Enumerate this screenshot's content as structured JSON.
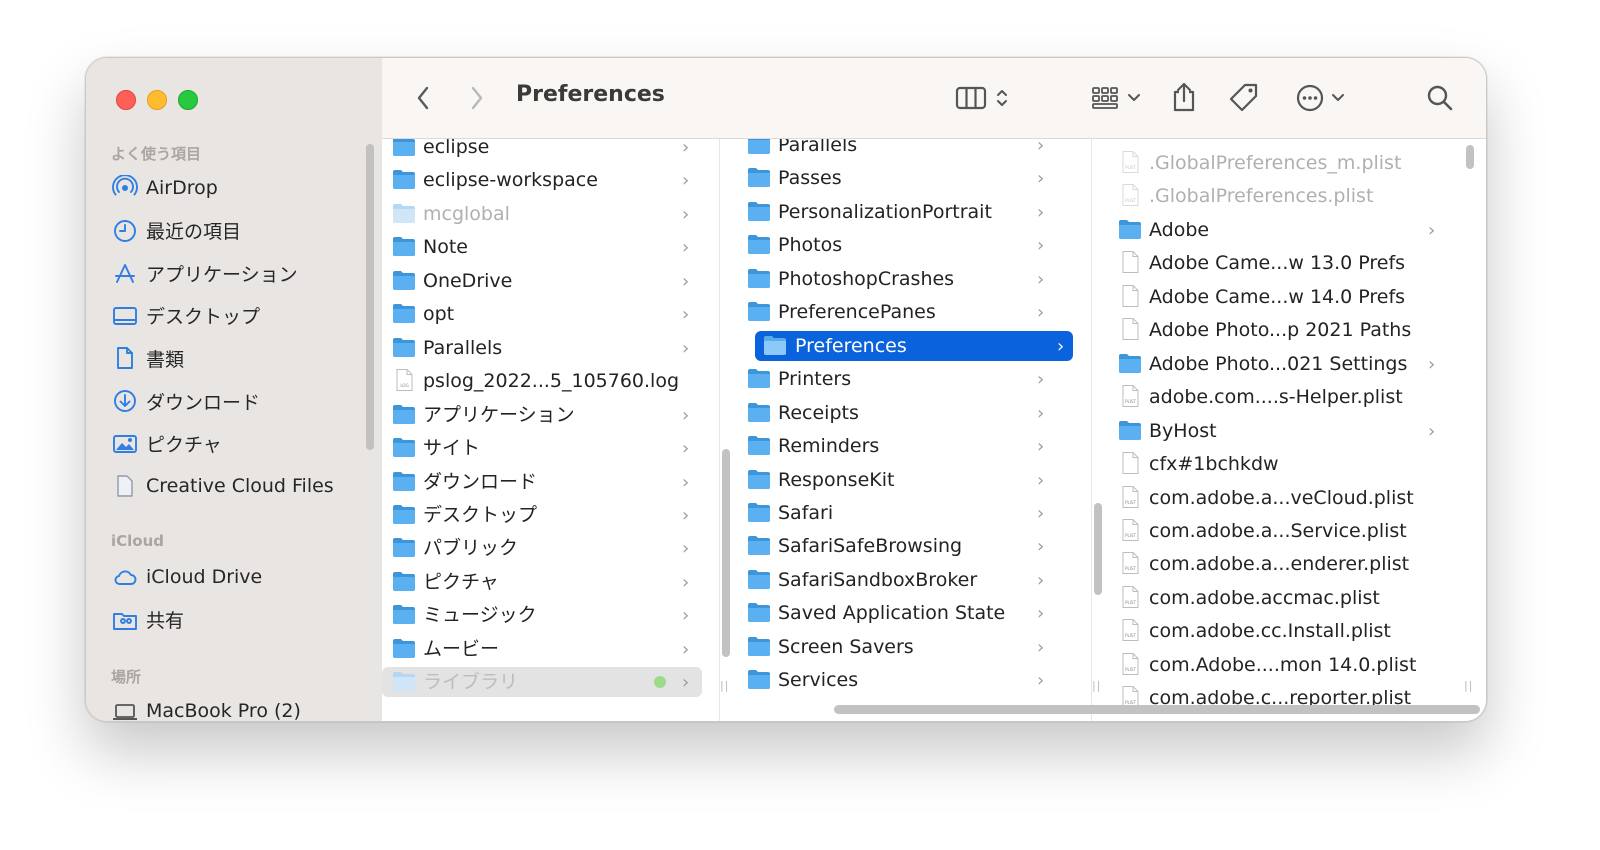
{
  "window": {
    "title": "Preferences"
  },
  "toolbar": {
    "back_icon": "chevron-left-icon",
    "forward_icon": "chevron-right-icon",
    "view_icon": "columns-view-icon",
    "group_icon": "grid-group-icon",
    "share_icon": "share-icon",
    "tag_icon": "tag-icon",
    "more_icon": "ellipsis-circle-icon",
    "search_icon": "search-icon"
  },
  "sidebar": {
    "favorites_header": "よく使う項目",
    "favorites": [
      {
        "label": "AirDrop",
        "icon": "airdrop-icon"
      },
      {
        "label": "最近の項目",
        "icon": "clock-icon"
      },
      {
        "label": "アプリケーション",
        "icon": "applications-icon"
      },
      {
        "label": "デスクトップ",
        "icon": "desktop-icon"
      },
      {
        "label": "書類",
        "icon": "document-icon"
      },
      {
        "label": "ダウンロード",
        "icon": "download-icon"
      },
      {
        "label": "ピクチャ",
        "icon": "photo-icon"
      },
      {
        "label": "Creative Cloud Files",
        "icon": "file-icon"
      }
    ],
    "icloud_header": "iCloud",
    "icloud": [
      {
        "label": "iCloud Drive",
        "icon": "cloud-icon"
      },
      {
        "label": "共有",
        "icon": "shared-folder-icon"
      }
    ],
    "locations_header": "場所",
    "locations": [
      {
        "label": "MacBook Pro (2)",
        "icon": "laptop-icon"
      }
    ]
  },
  "columns": {
    "col1": [
      {
        "name": "eclipse",
        "kind": "folder",
        "chevron": ">"
      },
      {
        "name": "eclipse-workspace",
        "kind": "folder",
        "chevron": ">"
      },
      {
        "name": "mcglobal",
        "kind": "folder-dim",
        "chevron": ">"
      },
      {
        "name": "Note",
        "kind": "folder",
        "chevron": ">"
      },
      {
        "name": "OneDrive",
        "kind": "folder",
        "chevron": ">"
      },
      {
        "name": "opt",
        "kind": "folder",
        "chevron": ">"
      },
      {
        "name": "Parallels",
        "kind": "folder",
        "chevron": ">"
      },
      {
        "name": "pslog_2022...5_105760.log",
        "kind": "log",
        "chevron": ""
      },
      {
        "name": "アプリケーション",
        "kind": "folder",
        "chevron": ">"
      },
      {
        "name": "サイト",
        "kind": "folder",
        "chevron": ">"
      },
      {
        "name": "ダウンロード",
        "kind": "folder",
        "chevron": ">"
      },
      {
        "name": "デスクトップ",
        "kind": "folder",
        "chevron": ">"
      },
      {
        "name": "パブリック",
        "kind": "folder",
        "chevron": ">"
      },
      {
        "name": "ピクチャ",
        "kind": "folder",
        "chevron": ">"
      },
      {
        "name": "ミュージック",
        "kind": "folder",
        "chevron": ">"
      },
      {
        "name": "ムービー",
        "kind": "folder",
        "chevron": ">"
      },
      {
        "name": "ライブラリ",
        "kind": "folder-dim",
        "chevron": ">",
        "state": "highlighted"
      }
    ],
    "col2": [
      {
        "name": "Parallels",
        "kind": "folder",
        "chevron": ">"
      },
      {
        "name": "Passes",
        "kind": "folder",
        "chevron": ">"
      },
      {
        "name": "PersonalizationPortrait",
        "kind": "folder",
        "chevron": ">"
      },
      {
        "name": "Photos",
        "kind": "folder",
        "chevron": ">"
      },
      {
        "name": "PhotoshopCrashes",
        "kind": "folder",
        "chevron": ">"
      },
      {
        "name": "PreferencePanes",
        "kind": "folder",
        "chevron": ">"
      },
      {
        "name": "Preferences",
        "kind": "folder",
        "chevron": ">",
        "state": "selected"
      },
      {
        "name": "Printers",
        "kind": "folder",
        "chevron": ">"
      },
      {
        "name": "Receipts",
        "kind": "folder",
        "chevron": ">"
      },
      {
        "name": "Reminders",
        "kind": "folder",
        "chevron": ">"
      },
      {
        "name": "ResponseKit",
        "kind": "folder",
        "chevron": ">"
      },
      {
        "name": "Safari",
        "kind": "folder",
        "chevron": ">"
      },
      {
        "name": "SafariSafeBrowsing",
        "kind": "folder",
        "chevron": ">"
      },
      {
        "name": "SafariSandboxBroker",
        "kind": "folder",
        "chevron": ">"
      },
      {
        "name": "Saved Application State",
        "kind": "folder",
        "chevron": ">"
      },
      {
        "name": "Screen Savers",
        "kind": "folder",
        "chevron": ">"
      },
      {
        "name": "Services",
        "kind": "folder",
        "chevron": ">"
      }
    ],
    "col3": [
      {
        "name": ".GlobalPreferences_m.plist",
        "kind": "plist-dim",
        "chevron": ""
      },
      {
        "name": ".GlobalPreferences.plist",
        "kind": "plist-dim",
        "chevron": ""
      },
      {
        "name": "Adobe",
        "kind": "folder",
        "chevron": ">"
      },
      {
        "name": "Adobe Came...w 13.0 Prefs",
        "kind": "file",
        "chevron": ""
      },
      {
        "name": "Adobe Came...w 14.0 Prefs",
        "kind": "file",
        "chevron": ""
      },
      {
        "name": "Adobe Photo...p 2021 Paths",
        "kind": "file",
        "chevron": ""
      },
      {
        "name": "Adobe Photo...021 Settings",
        "kind": "folder",
        "chevron": ">"
      },
      {
        "name": "adobe.com....s-Helper.plist",
        "kind": "plist",
        "chevron": ""
      },
      {
        "name": "ByHost",
        "kind": "folder",
        "chevron": ">"
      },
      {
        "name": "cfx#1bchkdw",
        "kind": "file",
        "chevron": ""
      },
      {
        "name": "com.adobe.a...veCloud.plist",
        "kind": "plist",
        "chevron": ""
      },
      {
        "name": "com.adobe.a...Service.plist",
        "kind": "plist",
        "chevron": ""
      },
      {
        "name": "com.adobe.a...enderer.plist",
        "kind": "plist",
        "chevron": ""
      },
      {
        "name": "com.adobe.accmac.plist",
        "kind": "plist",
        "chevron": ""
      },
      {
        "name": "com.adobe.cc.Install.plist",
        "kind": "plist",
        "chevron": ""
      },
      {
        "name": "com.Adobe....mon 14.0.plist",
        "kind": "plist",
        "chevron": ""
      },
      {
        "name": "com.adobe.c...reporter.plist",
        "kind": "plist",
        "chevron": ""
      }
    ]
  },
  "colors": {
    "accent": "#0a63dd",
    "folder": "#5ab0f0",
    "sidebar_icon": "#2f7fe3"
  }
}
